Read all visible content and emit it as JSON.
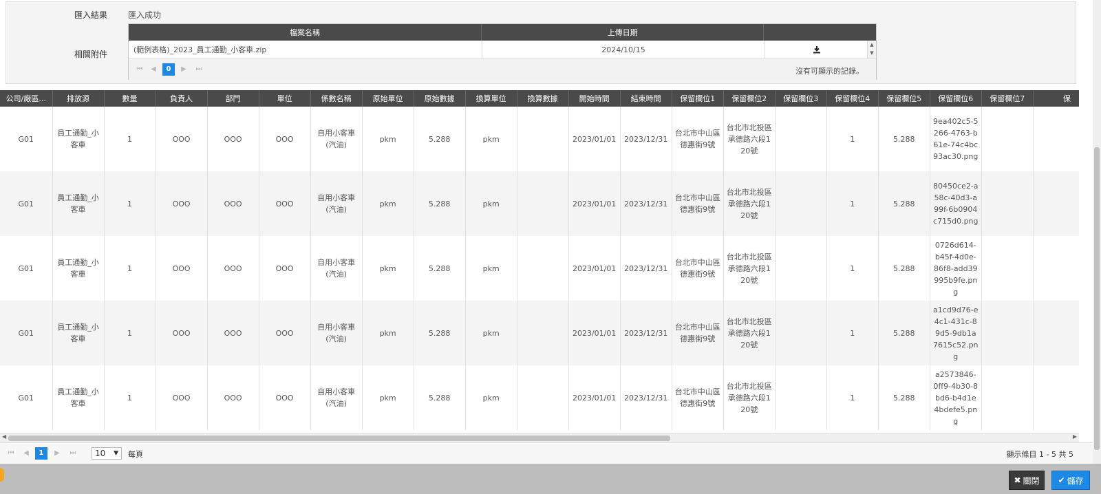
{
  "import_section": {
    "result_label": "匯入結果",
    "result_value": "匯入成功",
    "attachments_label": "相關附件",
    "grid": {
      "columns": [
        "檔案名稱",
        "上傳日期",
        ""
      ],
      "row": {
        "file_name": "(範例表格)_2023_員工通勤_小客車.zip",
        "upload_date": "2024/10/15",
        "action_icon": "download-icon"
      },
      "pager": {
        "current_page": "0",
        "empty_text": "沒有可顯示的記錄。"
      }
    }
  },
  "data_grid": {
    "columns": [
      "公司/廠區...",
      "排放源",
      "數量",
      "負責人",
      "部門",
      "單位",
      "係數名稱",
      "原始單位",
      "原始數據",
      "換算單位",
      "換算數據",
      "開始時間",
      "結束時間",
      "保留欄位1",
      "保留欄位2",
      "保留欄位3",
      "保留欄位4",
      "保留欄位5",
      "保留欄位6",
      "保留欄位7",
      "保"
    ],
    "rows": [
      [
        "G01",
        "員工通勤_小客車",
        "1",
        "OOO",
        "OOO",
        "OOO",
        "自用小客車(汽油)",
        "pkm",
        "5.288",
        "pkm",
        "",
        "2023/01/01",
        "2023/12/31",
        "台北市中山區德惠街9號",
        "台北市北投區承德路六段120號",
        "",
        "1",
        "5.288",
        "9ea402c5-5266-4763-b61e-74c4bc93ac30.png",
        "",
        ""
      ],
      [
        "G01",
        "員工通勤_小客車",
        "1",
        "OOO",
        "OOO",
        "OOO",
        "自用小客車(汽油)",
        "pkm",
        "5.288",
        "pkm",
        "",
        "2023/01/01",
        "2023/12/31",
        "台北市中山區德惠街9號",
        "台北市北投區承德路六段120號",
        "",
        "1",
        "5.288",
        "80450ce2-a58c-40d3-a99f-6b0904c715d0.png",
        "",
        ""
      ],
      [
        "G01",
        "員工通勤_小客車",
        "1",
        "OOO",
        "OOO",
        "OOO",
        "自用小客車(汽油)",
        "pkm",
        "5.288",
        "pkm",
        "",
        "2023/01/01",
        "2023/12/31",
        "台北市中山區德惠街9號",
        "台北市北投區承德路六段120號",
        "",
        "1",
        "5.288",
        "0726d614-b45f-4d0e-86f8-add39995b9fe.png",
        "",
        ""
      ],
      [
        "G01",
        "員工通勤_小客車",
        "1",
        "OOO",
        "OOO",
        "OOO",
        "自用小客車(汽油)",
        "pkm",
        "5.288",
        "pkm",
        "",
        "2023/01/01",
        "2023/12/31",
        "台北市中山區德惠街9號",
        "台北市北投區承德路六段120號",
        "",
        "1",
        "5.288",
        "a1cd9d76-e4c1-431c-89d5-9db1a7615c52.png",
        "",
        ""
      ],
      [
        "G01",
        "員工通勤_小客車",
        "1",
        "OOO",
        "OOO",
        "OOO",
        "自用小客車(汽油)",
        "pkm",
        "5.288",
        "pkm",
        "",
        "2023/01/01",
        "2023/12/31",
        "台北市中山區德惠街9號",
        "台北市北投區承德路六段120號",
        "",
        "1",
        "5.288",
        "a2573846-0ff9-4b30-8bd6-b4d1e4bdefe5.png",
        "",
        ""
      ]
    ],
    "pager": {
      "current_page": "1",
      "page_size": "10",
      "per_page_label": "每頁",
      "summary": "顯示條目 1 - 5 共 5"
    }
  },
  "footer": {
    "close_label": "關閉",
    "save_label": "儲存"
  },
  "colors": {
    "header_bg": "#4a4a4a",
    "accent": "#1e88e5",
    "close_bg": "#3a3a3a"
  }
}
